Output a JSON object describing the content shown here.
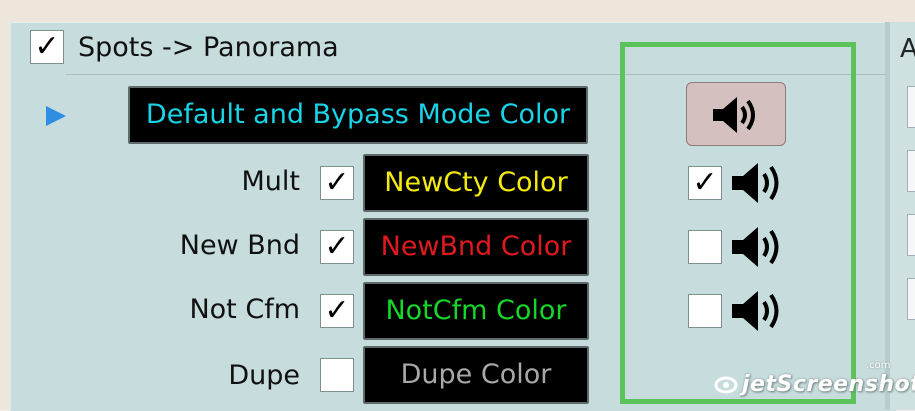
{
  "group": {
    "title": "Spots -> Panorama",
    "enabled_check": "✓"
  },
  "default_row": {
    "button_label": "Default and Bypass Mode Color",
    "button_text_color": "#19d3e6"
  },
  "rows": [
    {
      "label": "Mult",
      "checked": "✓",
      "color_button": "NewCty Color",
      "text_color": "#f4ea10",
      "sound_checked": "✓"
    },
    {
      "label": "New Bnd",
      "checked": "✓",
      "color_button": "NewBnd Color",
      "text_color": "#e0191e",
      "sound_checked": ""
    },
    {
      "label": "Not Cfm",
      "checked": "✓",
      "color_button": "NotCfm Color",
      "text_color": "#16d62a",
      "sound_checked": ""
    },
    {
      "label": "Dupe",
      "checked": "",
      "color_button": "Dupe Color",
      "text_color": "#a8a8a8",
      "sound_checked": ""
    }
  ],
  "right_pane": {
    "partial_label": "A"
  },
  "watermark": {
    "text": "jetScreenshot",
    "suffix": ".com"
  },
  "colors": {
    "highlight_box": "#5cc25a",
    "panel_bg": "#c7dcdd",
    "sound_button_bg": "#d4c0be"
  },
  "icons": {
    "play_arrow": "play-arrow-icon",
    "speaker": "speaker-icon"
  }
}
